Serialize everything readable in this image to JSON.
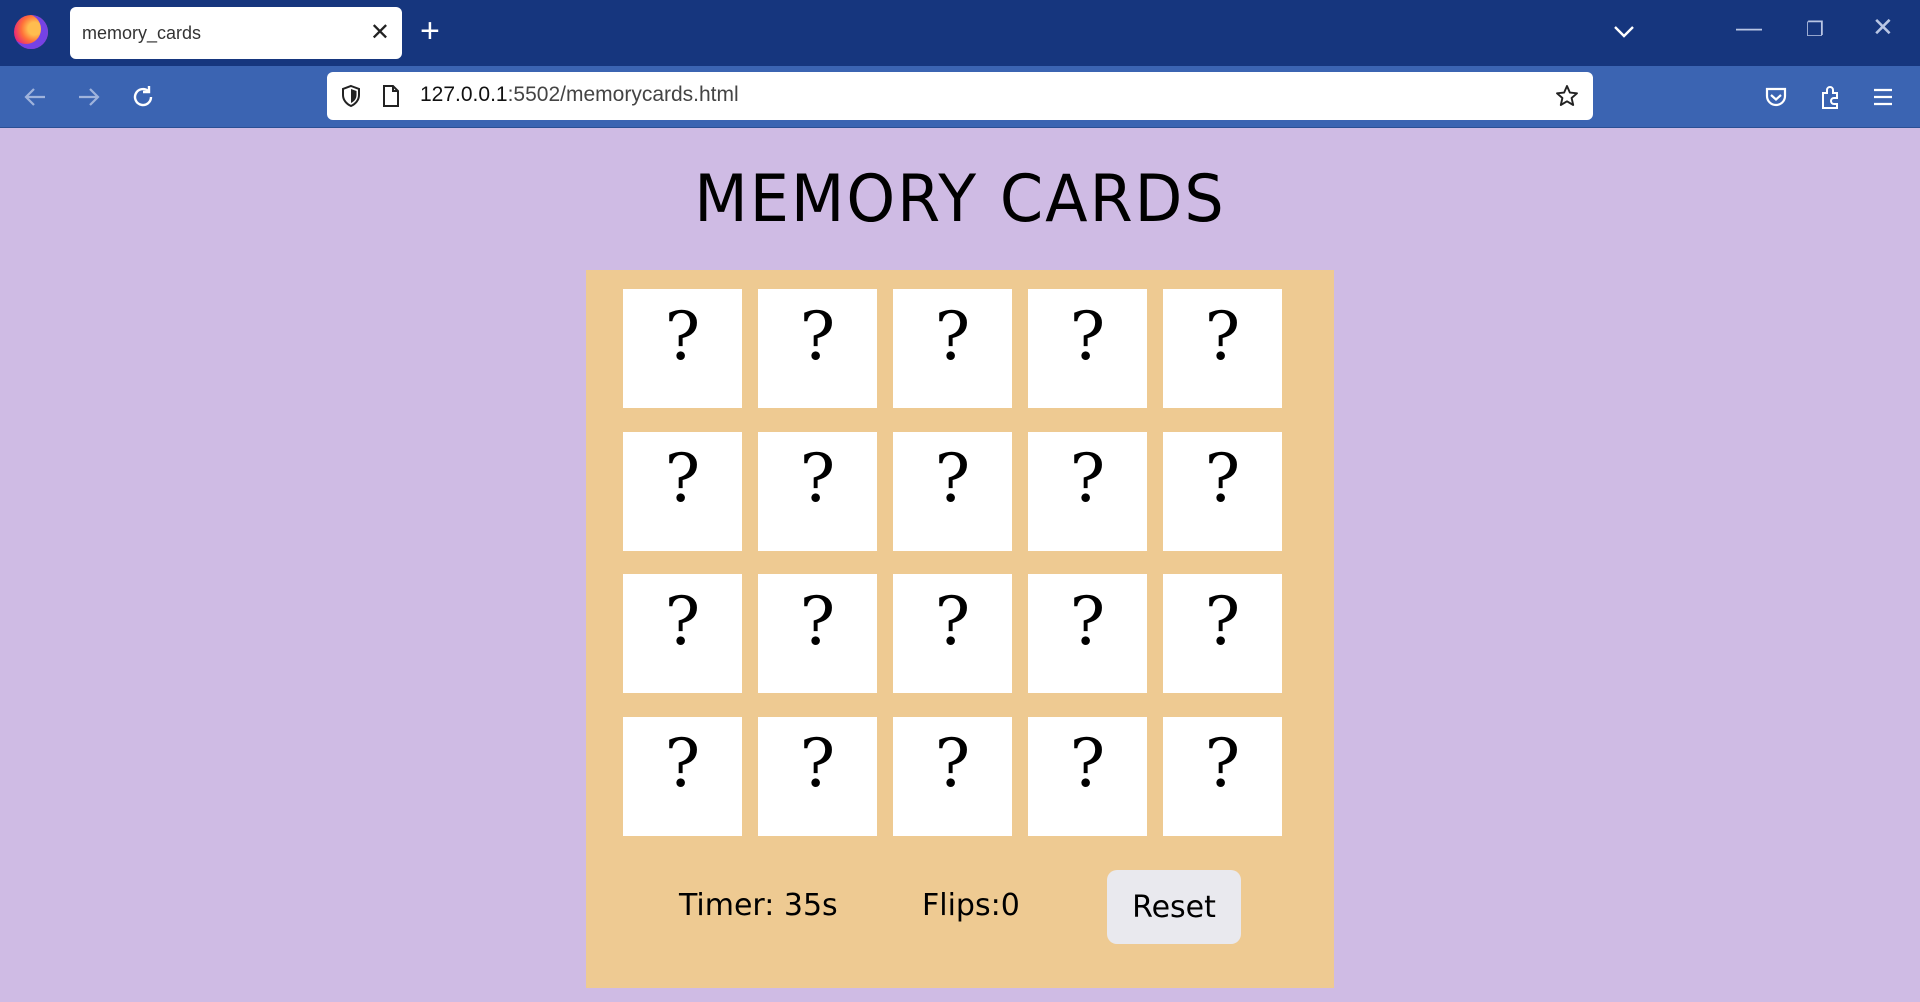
{
  "browser": {
    "tab_title": "memory_cards",
    "tab_close": "✕",
    "new_tab": "+",
    "url_host": "127.0.0.1",
    "url_rest": ":5502/memorycards.html",
    "icons": [
      "firefox-icon",
      "back-icon",
      "forward-icon",
      "reload-icon",
      "shield-icon",
      "page-icon",
      "star-icon",
      "pocket-icon",
      "extensions-icon",
      "menu-icon"
    ],
    "window_controls": {
      "minimize": "—",
      "restore": "❐",
      "close": "✕"
    }
  },
  "page": {
    "title": "MEMORY CARDS",
    "card_face": "?",
    "rows": 4,
    "columns": 5,
    "timer": "Timer: 35s",
    "flips": "Flips:0",
    "reset_label": "Reset"
  },
  "colors": {
    "background": "#cfbbe4",
    "board": "#eeca92",
    "card": "#ffffff",
    "tab_strip": "#16367e",
    "toolbar": "#3b64b2"
  }
}
